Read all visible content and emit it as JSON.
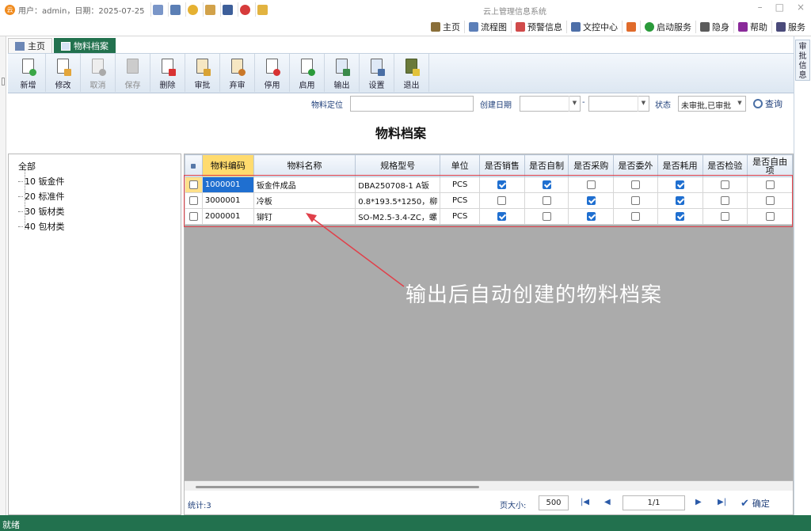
{
  "titlebar": {
    "user_info": "用户：admin，日期：2025-07-25",
    "window_title": "云上管理信息系统",
    "win_min": "–",
    "win_max": "□",
    "win_close": "×"
  },
  "menu": {
    "items": [
      "主页",
      "流程图",
      "预警信息",
      "文控中心",
      "启动服务",
      "隐身",
      "帮助",
      "服务"
    ]
  },
  "side_tab": {
    "label": "审批信息"
  },
  "tabs": [
    {
      "label": "主页"
    },
    {
      "label": "物料档案"
    }
  ],
  "toolbar": {
    "buttons": [
      "新增",
      "修改",
      "取消",
      "保存",
      "删除",
      "审批",
      "弃审",
      "停用",
      "启用",
      "输出",
      "设置",
      "退出"
    ]
  },
  "filter": {
    "locate_label": "物料定位",
    "locate_value": "",
    "date_label": "创建日期",
    "date_sep": "-",
    "status_label": "状态",
    "status_value": "未审批,已审批",
    "query_label": "查询"
  },
  "page": {
    "title": "物料档案"
  },
  "tree": {
    "root": "全部",
    "children": [
      "10 钣金件",
      "20 标准件",
      "30 钣材类",
      "40 包材类"
    ]
  },
  "grid": {
    "columns": [
      "物料编码",
      "物料名称",
      "规格型号",
      "单位",
      "是否销售",
      "是否自制",
      "是否采购",
      "是否委外",
      "是否耗用",
      "是否检验",
      "是否自由项"
    ],
    "rows": [
      {
        "code": "1000001",
        "name": "钣金件成品",
        "spec": "DBA250708-1 A钣",
        "unit": "PCS",
        "flags": [
          true,
          true,
          false,
          false,
          true,
          false,
          false
        ]
      },
      {
        "code": "3000001",
        "name": "冷板",
        "spec": "0.8*193.5*1250，柳",
        "unit": "PCS",
        "flags": [
          false,
          false,
          true,
          false,
          true,
          false,
          false
        ]
      },
      {
        "code": "2000001",
        "name": "铆钉",
        "spec": "SO-M2.5-3.4-ZC，螺",
        "unit": "PCS",
        "flags": [
          true,
          false,
          true,
          false,
          true,
          false,
          false
        ]
      }
    ]
  },
  "pager": {
    "count_label": "统计:3",
    "pagesize_label": "页大小:",
    "pagesize_value": "500",
    "page_value": "1/1",
    "confirm_label": "确定"
  },
  "status": {
    "text": "就绪"
  },
  "annotation": {
    "text": "输出后自动创建的物料档案"
  },
  "colors": {
    "accent": "#22714e",
    "highlight": "#e0404a",
    "selection": "#1f6fd0"
  }
}
